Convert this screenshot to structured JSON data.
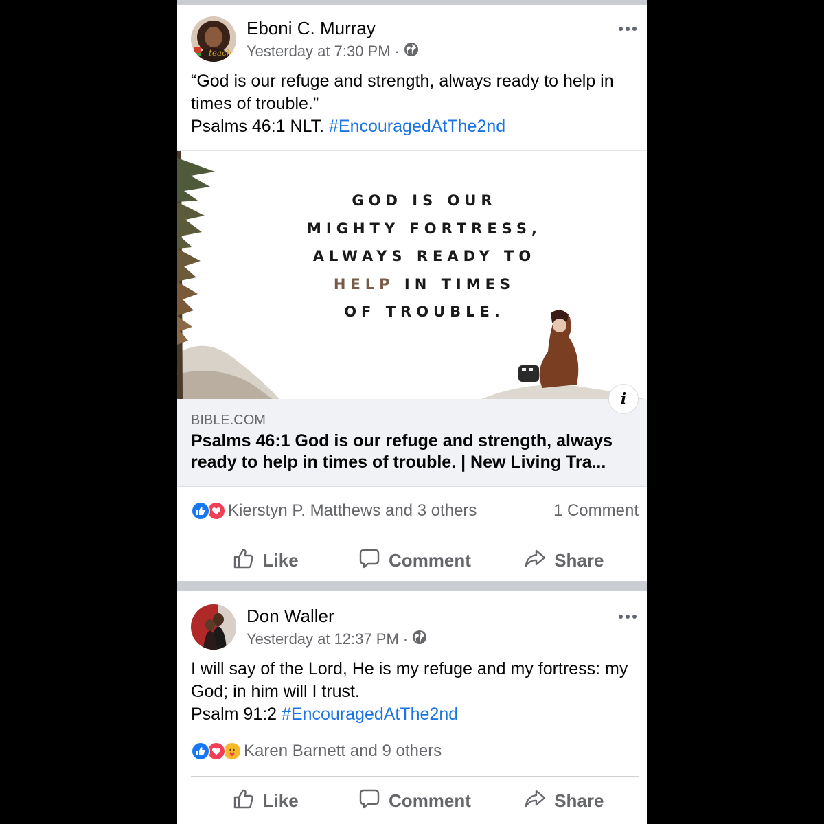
{
  "post1": {
    "author": "Eboni C. Murray",
    "time": "Yesterday at 7:30 PM",
    "separator": "·",
    "avatar_text": "teache",
    "text_line1": "“God is our refuge and strength, always ready to help in times of trouble.”",
    "text_ref": "Psalms 46:1 NLT.",
    "hashtag": "#EncouragedAtThe2nd",
    "image_quote": {
      "line1": "GOD IS OUR",
      "line2": "MIGHTY FORTRESS,",
      "line3": "ALWAYS READY TO",
      "line4_help": "HELP",
      "line4_rest": " IN TIMES",
      "line5": "OF TROUBLE."
    },
    "link_domain": "BIBLE.COM",
    "link_title": "Psalms 46:1 God is our refuge and strength, always ready to help in times of trouble. | New Living Tra...",
    "info_icon": "i",
    "reactions_text": "Kierstyn P. Matthews and 3 others",
    "comments": "1 Comment",
    "actions": {
      "like": "Like",
      "comment": "Comment",
      "share": "Share"
    }
  },
  "post2": {
    "author": "Don Waller",
    "time": "Yesterday at 12:37 PM",
    "separator": "·",
    "text_line1": "I will say of the Lord, He is my refuge and my fortress: my God; in him will I trust.",
    "text_ref": "Psalm 91:2",
    "hashtag": "#EncouragedAtThe2nd",
    "reactions_text": "Karen Barnett and 9 others",
    "actions": {
      "like": "Like",
      "comment": "Comment",
      "share": "Share"
    }
  },
  "colors": {
    "hashtag": "#1b74e4",
    "secondary_text": "#65676b",
    "like_reaction": "#1877f2",
    "love_reaction": "#f33e58",
    "care_reaction": "#f7b928",
    "feed_background": "#cacdd2"
  }
}
